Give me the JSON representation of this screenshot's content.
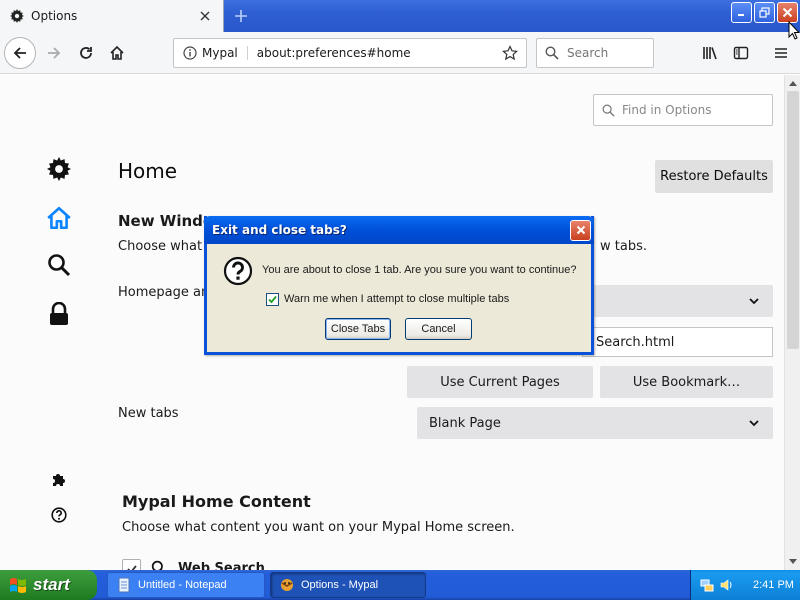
{
  "window": {
    "tab_title": "Options",
    "new_tab_symbol": "+"
  },
  "navbar": {
    "identity_label": "Mypal",
    "url": "about:preferences#home",
    "search_placeholder": "Search"
  },
  "prefs": {
    "find_placeholder": "Find in Options",
    "page_title": "Home",
    "restore_defaults": "Restore Defaults",
    "restore_defaults_access": "R",
    "new_windows_heading": "New Windo",
    "new_windows_desc": "Choose what y",
    "new_windows_desc_tail": "w tabs.",
    "homepage_label": "Homepage and",
    "homepage_url_value": "Search.html",
    "use_current_pages": "Use Current Pages",
    "use_bookmark": "Use Bookmark…",
    "new_tabs_label": "New tabs",
    "new_tabs_value": "Blank Page",
    "home_content_heading": "Mypal Home Content",
    "home_content_desc": "Choose what content you want on your Mypal Home screen.",
    "web_search_label": "Web Search"
  },
  "dialog": {
    "title": "Exit and close tabs?",
    "message": "You are about to close 1 tab. Are you sure you want to continue?",
    "warn_label": "Warn me when I attempt to close multiple tabs",
    "warn_checked": true,
    "close_tabs_label": "Close Tabs",
    "cancel_label": "Cancel"
  },
  "taskbar": {
    "start_label": "start",
    "tasks": [
      {
        "label": "Untitled - Notepad"
      },
      {
        "label": "Options - Mypal"
      }
    ],
    "clock": "2:41 PM"
  },
  "icons": {
    "tab": "gear-icon",
    "categories": [
      "gear-icon",
      "home-icon",
      "search-icon",
      "lock-icon",
      "puzzle-icon",
      "help-icon"
    ]
  },
  "colors": {
    "accent": "#0a84ff",
    "xp_blue": "#0a53d8",
    "dialog_bg": "#ece9d8"
  }
}
